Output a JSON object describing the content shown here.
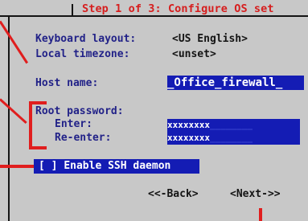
{
  "screen": {
    "title": "Step 1 of 3: Configure OS set",
    "keyboard_layout": {
      "label": "Keyboard layout:",
      "value": "<US English>"
    },
    "local_timezone": {
      "label": "Local timezone:",
      "value": "<unset>"
    },
    "host_name": {
      "label": "Host name:",
      "value": "_Office_firewall_"
    },
    "root_password": {
      "label": "Root password:",
      "enter_label": "Enter:",
      "enter_mask": "xxxxxxxx",
      "enter_rest": "________",
      "reenter_label": "Re-enter:",
      "reenter_mask": "xxxxxxxx",
      "reenter_rest": "________"
    },
    "ssh": {
      "checkbox": "[ ]",
      "label": "Enable SSH daemon"
    },
    "buttons": {
      "back": "<<-Back>",
      "next": "<Next->>"
    }
  },
  "colors": {
    "background": "#c8c8c8",
    "title": "#d61e1e",
    "label": "#222288",
    "field_bg": "#141cb4",
    "annotation": "#e01e1e"
  }
}
